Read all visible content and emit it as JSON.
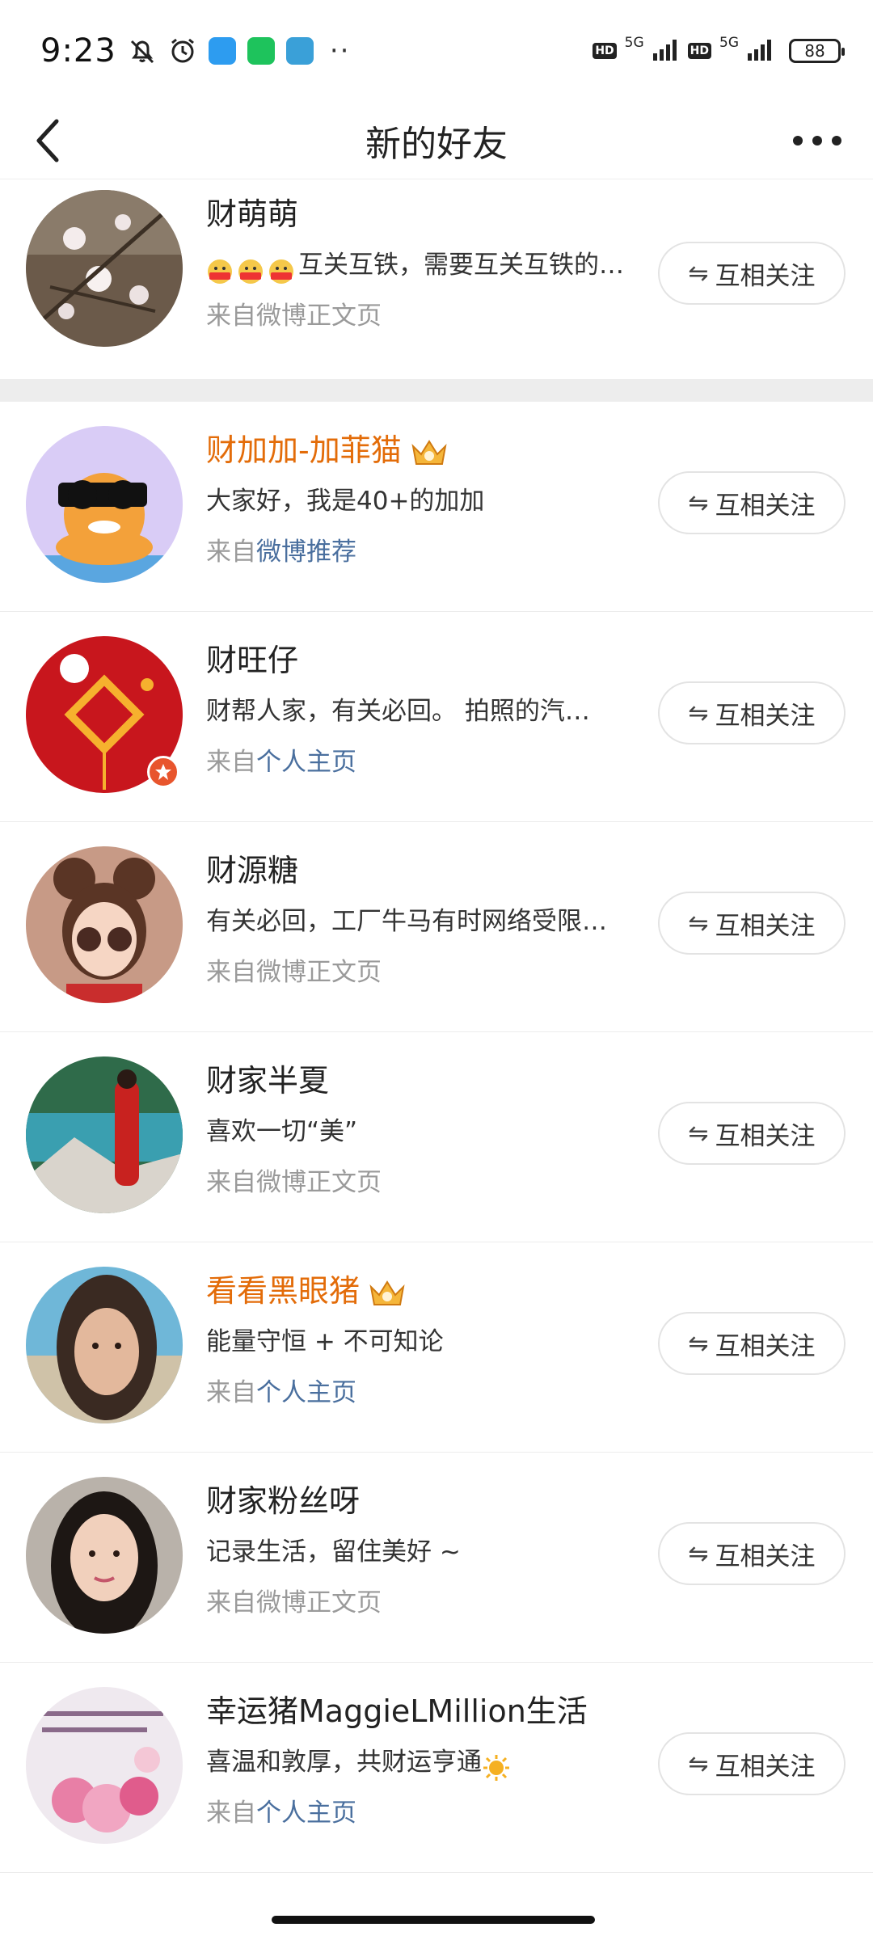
{
  "status": {
    "time": "9:23",
    "network1": "5G",
    "network2": "5G",
    "hd": "HD",
    "battery": "88"
  },
  "header": {
    "title": "新的好友"
  },
  "colors": {
    "vip_name": "#e36c09",
    "link": "#4a6f9e",
    "source_gray": "#9a9a9a"
  },
  "friends": [
    {
      "name": "财萌萌",
      "desc": "互关互铁，需要互关互铁的…",
      "source_prefix": "来自微博正文页",
      "source_link": "",
      "button": "互相关注"
    },
    {
      "name": "财加加-加菲猫",
      "desc": "大家好，我是40+的加加",
      "source_prefix": "来自",
      "source_link": "微博推荐",
      "button": "互相关注"
    },
    {
      "name": "财旺仔",
      "desc": "财帮人家，有关必回。 拍照的汽…",
      "source_prefix": "来自",
      "source_link": "个人主页",
      "button": "互相关注"
    },
    {
      "name": "财源糖",
      "desc": "有关必回，工厂牛马有时网络受限…",
      "source_prefix": "来自微博正文页",
      "source_link": "",
      "button": "互相关注"
    },
    {
      "name": "财家半夏",
      "desc": "喜欢一切“美”",
      "source_prefix": "来自微博正文页",
      "source_link": "",
      "button": "互相关注"
    },
    {
      "name": "看看黑眼猪",
      "desc": "能量守恒 + 不可知论",
      "source_prefix": "来自",
      "source_link": "个人主页",
      "button": "互相关注"
    },
    {
      "name": "财家粉丝呀",
      "desc": "记录生活，留住美好 ~",
      "source_prefix": "来自微博正文页",
      "source_link": "",
      "button": "互相关注"
    },
    {
      "name": "幸运猪MaggieLMillion生活",
      "desc": "喜温和敦厚，共财运亨通",
      "source_prefix": "来自",
      "source_link": "个人主页",
      "button": "互相关注"
    }
  ]
}
